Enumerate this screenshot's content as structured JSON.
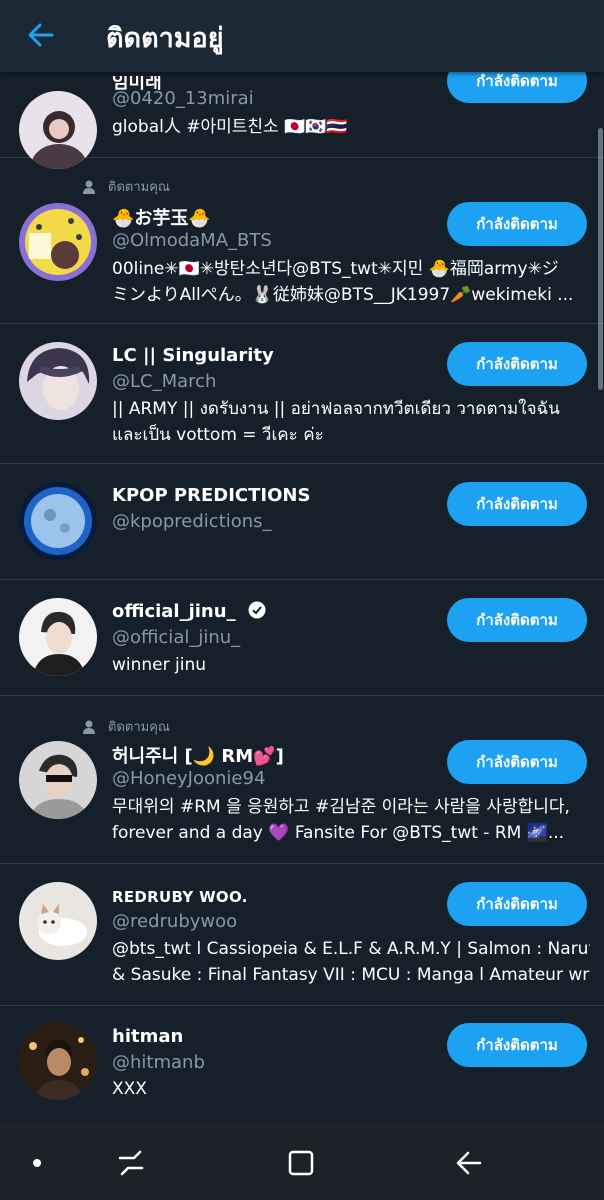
{
  "header": {
    "title": "ติดตามอยู่"
  },
  "button_label": "กำลังติดตาม",
  "follows_you_label": "ติดตามคุณ",
  "users": [
    {
      "name": "임미래",
      "handle": "@0420_13mirai",
      "bio1": "global人 #아미트친소 🇯🇵🇰🇷🇹🇭",
      "bio2": ""
    },
    {
      "name": "🐣お芋玉🐣",
      "handle": "@OlmodaMA_BTS",
      "bio1": "00line✳🇯🇵✳방탄소년다@BTS_twt✳지민 🐣福岡army✳ジ",
      "bio2": "ミンよりAllぺん。🐰従姉妹@BTS__JK1997🥕wekimeki ..."
    },
    {
      "name": "LC || Singularity",
      "handle": "@LC_March",
      "bio1": "|| ARMY || งดรับงาน || อย่าฟอลจากทวีตเดียว วาดตามใจฉัน",
      "bio2": "และเป็น vottom = วีเคะ ค่ะ"
    },
    {
      "name": "KPOP PREDICTIONS",
      "handle": "@kpopredictions_",
      "bio1": "",
      "bio2": ""
    },
    {
      "name": "official_jinu_",
      "handle": "@official_jinu_",
      "bio1": "winner jinu",
      "bio2": ""
    },
    {
      "name": "허니주니 [🌙 RM💕]",
      "handle": "@HoneyJoonie94",
      "bio1": "무대위의 #RM 을 응원하고 #김남준 이라는 사람을 사랑합니다,",
      "bio2": "forever and a day 💜 Fansite For @BTS_twt - RM 🌌..."
    },
    {
      "name": "REDRUBY WOO.",
      "handle": "@redrubywoo",
      "bio1": "@bts_twt l Cassiopeia & E.L.F & A.R.M.Y | Salmon : Naruto",
      "bio2": "& Sasuke : Final Fantasy VII : MCU : Manga l Amateur wri..."
    },
    {
      "name": "hitman",
      "handle": "@hitmanb",
      "bio1": "XXX",
      "bio2": ""
    }
  ]
}
